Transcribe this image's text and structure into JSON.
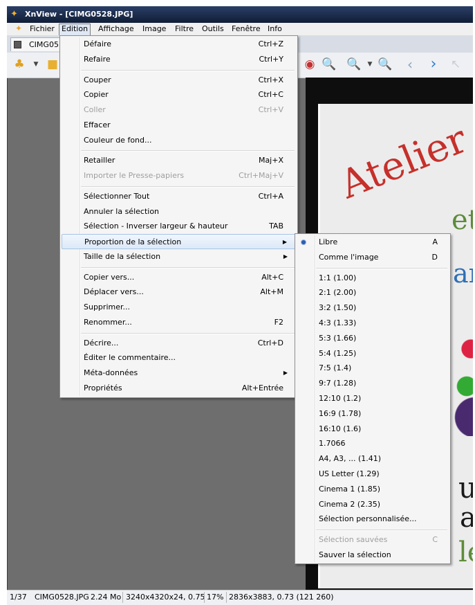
{
  "window": {
    "title": "XnView - [CIMG0528.JPG]"
  },
  "menubar": [
    "Fichier",
    "Edition",
    "Affichage",
    "Image",
    "Filtre",
    "Outils",
    "Fenêtre",
    "Info"
  ],
  "tab": {
    "label": "CIMG05"
  },
  "edit_menu": [
    {
      "label": "Défaire",
      "shortcut": "Ctrl+Z",
      "disabled": false,
      "submenu": false
    },
    {
      "label": "Refaire",
      "shortcut": "Ctrl+Y",
      "disabled": false,
      "submenu": false
    },
    {
      "separator": true
    },
    {
      "label": "Couper",
      "shortcut": "Ctrl+X",
      "disabled": false,
      "submenu": false
    },
    {
      "label": "Copier",
      "shortcut": "Ctrl+C",
      "disabled": false,
      "submenu": false
    },
    {
      "label": "Coller",
      "shortcut": "Ctrl+V",
      "disabled": true,
      "submenu": false
    },
    {
      "label": "Effacer",
      "shortcut": "",
      "disabled": false,
      "submenu": false
    },
    {
      "label": "Couleur de fond...",
      "shortcut": "",
      "disabled": false,
      "submenu": false
    },
    {
      "separator": true
    },
    {
      "label": "Retailler",
      "shortcut": "Maj+X",
      "disabled": false,
      "submenu": false
    },
    {
      "label": "Importer le Presse-papiers",
      "shortcut": "Ctrl+Maj+V",
      "disabled": true,
      "submenu": false
    },
    {
      "separator": true
    },
    {
      "label": "Sélectionner Tout",
      "shortcut": "Ctrl+A",
      "disabled": false,
      "submenu": false
    },
    {
      "label": "Annuler la sélection",
      "shortcut": "",
      "disabled": false,
      "submenu": false
    },
    {
      "label": "Sélection - Inverser largeur & hauteur",
      "shortcut": "TAB",
      "disabled": false,
      "submenu": false
    },
    {
      "label": "Proportion de la sélection",
      "shortcut": "",
      "disabled": false,
      "submenu": true,
      "highlighted": true
    },
    {
      "label": "Taille de la sélection",
      "shortcut": "",
      "disabled": false,
      "submenu": true
    },
    {
      "separator": true
    },
    {
      "label": "Copier vers...",
      "shortcut": "Alt+C",
      "disabled": false,
      "submenu": false
    },
    {
      "label": "Déplacer vers...",
      "shortcut": "Alt+M",
      "disabled": false,
      "submenu": false
    },
    {
      "label": "Supprimer...",
      "shortcut": "",
      "disabled": false,
      "submenu": false
    },
    {
      "label": "Renommer...",
      "shortcut": "F2",
      "disabled": false,
      "submenu": false
    },
    {
      "separator": true
    },
    {
      "label": "Décrire...",
      "shortcut": "Ctrl+D",
      "disabled": false,
      "submenu": false
    },
    {
      "label": "Éditer le commentaire...",
      "shortcut": "",
      "disabled": false,
      "submenu": false
    },
    {
      "label": "Méta-données",
      "shortcut": "",
      "disabled": false,
      "submenu": true
    },
    {
      "label": "Propriétés",
      "shortcut": "Alt+Entrée",
      "disabled": false,
      "submenu": false
    }
  ],
  "proportion_menu": [
    {
      "label": "Libre",
      "shortcut": "A",
      "checked": true
    },
    {
      "label": "Comme l'image",
      "shortcut": "D"
    },
    {
      "separator": true
    },
    {
      "label": "1:1 (1.00)",
      "shortcut": ""
    },
    {
      "label": "2:1 (2.00)",
      "shortcut": ""
    },
    {
      "label": "3:2 (1.50)",
      "shortcut": ""
    },
    {
      "label": "4:3 (1.33)",
      "shortcut": ""
    },
    {
      "label": "5:3 (1.66)",
      "shortcut": ""
    },
    {
      "label": "5:4 (1.25)",
      "shortcut": ""
    },
    {
      "label": "7:5 (1.4)",
      "shortcut": ""
    },
    {
      "label": "9:7 (1.28)",
      "shortcut": ""
    },
    {
      "label": "12:10 (1.2)",
      "shortcut": ""
    },
    {
      "label": "16:9 (1.78)",
      "shortcut": ""
    },
    {
      "label": "16:10 (1.6)",
      "shortcut": ""
    },
    {
      "label": "1.7066",
      "shortcut": ""
    },
    {
      "label": "A4, A3, ... (1.41)",
      "shortcut": ""
    },
    {
      "label": "US Letter (1.29)",
      "shortcut": ""
    },
    {
      "label": "Cinema 1 (1.85)",
      "shortcut": ""
    },
    {
      "label": "Cinema 2 (2.35)",
      "shortcut": ""
    },
    {
      "label": "Sélection personnalisée...",
      "shortcut": ""
    },
    {
      "separator": true
    },
    {
      "label": "Sélection sauvées",
      "shortcut": "C",
      "disabled": true
    },
    {
      "label": "Sauver la sélection",
      "shortcut": ""
    }
  ],
  "photo_text": {
    "atelier": "Atelier S",
    "t1": "et",
    "an": "an",
    "ur": "ur",
    "all": "all",
    "le": "le"
  },
  "statusbar": [
    "1/37",
    "CIMG0528.JPG",
    "2.24 Mo",
    "3240x4320x24, 0.75",
    "17%",
    "2836x3883, 0.73 (121 260)"
  ]
}
